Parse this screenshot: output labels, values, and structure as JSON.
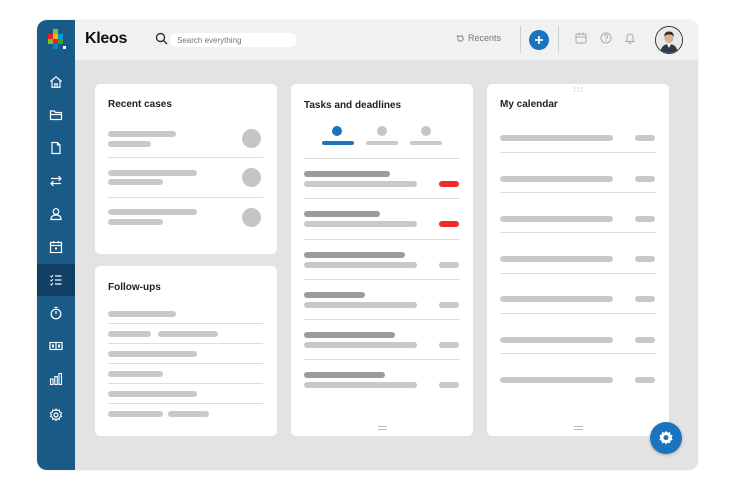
{
  "app": {
    "title": "Kleos"
  },
  "search": {
    "placeholder": "Search everything"
  },
  "header": {
    "recents_label": "Recents"
  },
  "sidebar": {
    "items": [
      {
        "icon": "home-icon"
      },
      {
        "icon": "folder-icon"
      },
      {
        "icon": "document-icon"
      },
      {
        "icon": "transfer-icon"
      },
      {
        "icon": "user-icon"
      },
      {
        "icon": "calendar-icon"
      },
      {
        "icon": "checklist-icon",
        "active": true
      },
      {
        "icon": "timer-icon"
      },
      {
        "icon": "billing-icon"
      },
      {
        "icon": "reports-icon"
      },
      {
        "icon": "settings-icon"
      }
    ]
  },
  "widgets": {
    "recent_cases": {
      "title": "Recent cases"
    },
    "follow_ups": {
      "title": "Follow-ups"
    },
    "tasks": {
      "title": "Tasks and deadlines"
    },
    "calendar": {
      "title": "My calendar"
    }
  },
  "colors": {
    "brand": "#1a5a87",
    "accent": "#1a74bf",
    "alert": "#ee2a2a"
  }
}
